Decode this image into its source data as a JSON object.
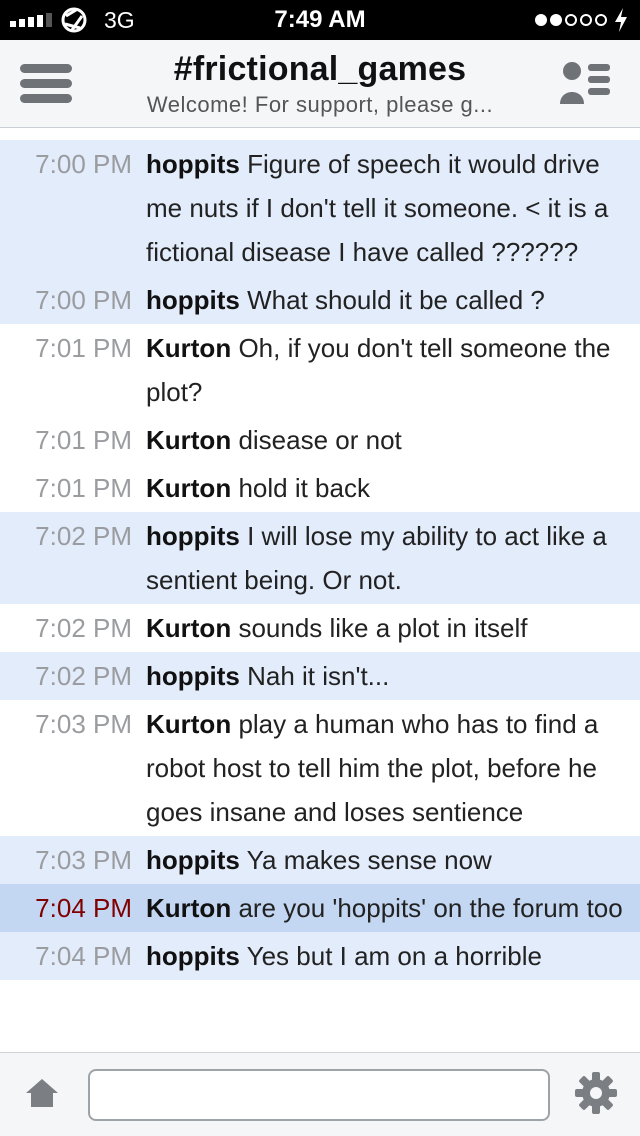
{
  "status_bar": {
    "network": "3G",
    "time": "7:49 AM"
  },
  "header": {
    "channel": "#frictional_games",
    "topic": "Welcome! For support, please g..."
  },
  "messages": [
    {
      "time": "7:00 PM",
      "nick": "hoppits",
      "text": "Figure of speech it would drive me nuts if I don't tell it someone. < it is a fictional disease I have called ??????",
      "style": "alt"
    },
    {
      "time": "7:00 PM",
      "nick": "hoppits",
      "text": "What should it be called ?",
      "style": "alt"
    },
    {
      "time": "7:01 PM",
      "nick": "Kurton",
      "text": "Oh, if you don't tell someone the plot?",
      "style": "plain"
    },
    {
      "time": "7:01 PM",
      "nick": "Kurton",
      "text": "disease or not",
      "style": "plain"
    },
    {
      "time": "7:01 PM",
      "nick": "Kurton",
      "text": "hold it back",
      "style": "plain"
    },
    {
      "time": "7:02 PM",
      "nick": "hoppits",
      "text": "I will lose my ability to act like a sentient being. Or not.",
      "style": "alt"
    },
    {
      "time": "7:02 PM",
      "nick": "Kurton",
      "text": "sounds like a plot in itself",
      "style": "plain"
    },
    {
      "time": "7:02 PM",
      "nick": "hoppits",
      "text": "Nah it isn't...",
      "style": "alt"
    },
    {
      "time": "7:03 PM",
      "nick": "Kurton",
      "text": "play a human who has to find a robot host to tell him the plot, before he goes insane and loses sentience",
      "style": "plain"
    },
    {
      "time": "7:03 PM",
      "nick": "hoppits",
      "text": "Ya makes sense now",
      "style": "alt"
    },
    {
      "time": "7:04 PM",
      "nick": "Kurton",
      "text": "are you 'hoppits' on the forum too",
      "style": "highlight"
    },
    {
      "time": "7:04 PM",
      "nick": "hoppits",
      "text": "Yes but I am on a horrible",
      "style": "alt"
    }
  ],
  "input": {
    "value": "",
    "placeholder": ""
  },
  "icons": {
    "menu": "menu-icon",
    "users": "users-icon",
    "home": "home-icon",
    "settings": "gear-icon"
  },
  "colors": {
    "alt_row": "#e3ecfb",
    "highlight_row": "#c3d7f3",
    "highlight_time": "#800000"
  }
}
